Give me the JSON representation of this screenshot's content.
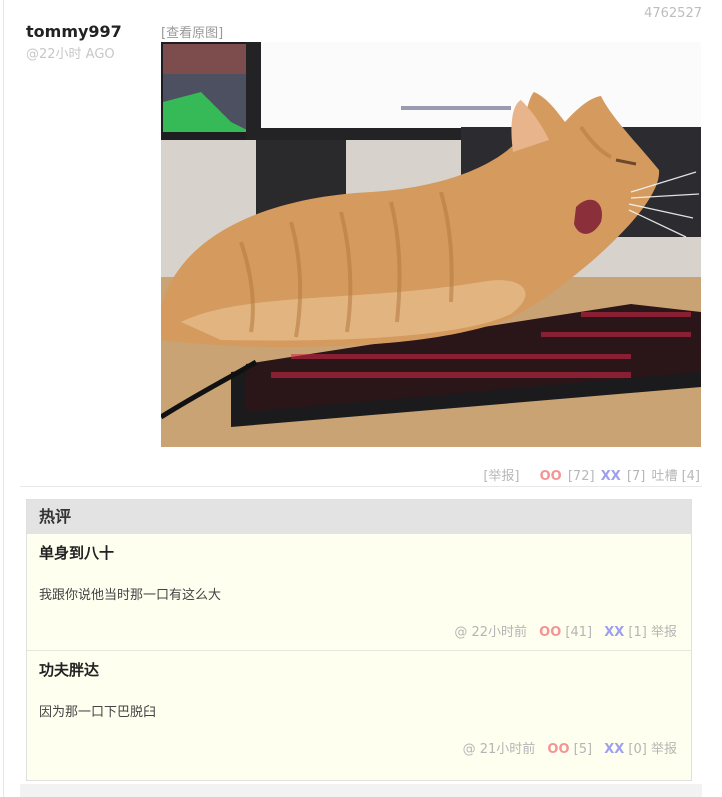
{
  "post": {
    "id": "4762527",
    "author": "tommy997",
    "time": "@22小时 AGO",
    "view_original": "[查看原图]",
    "report": "[举报]",
    "oo_label": "OO",
    "oo_count": "[72]",
    "xx_label": "XX",
    "xx_count": "[7]",
    "tucao": "吐槽 [4]"
  },
  "hot": {
    "title": "热评",
    "comments": [
      {
        "author": "单身到八十",
        "text": "我跟你说他当时那一口有这么大",
        "at": "@",
        "time": "22小时前",
        "oo_label": "OO",
        "oo_count": "[41]",
        "xx_label": "XX",
        "xx_count": "[1]",
        "report": "举报"
      },
      {
        "author": "功夫胖达",
        "text": "因为那一口下巴脱臼",
        "at": "@",
        "time": "21小时前",
        "oo_label": "OO",
        "oo_count": "[5]",
        "xx_label": "XX",
        "xx_count": "[0]",
        "report": "举报"
      }
    ]
  },
  "colors": {
    "oo": "#f49595",
    "xx": "#9f9ff0",
    "hot_bg": "#fffff0",
    "hot_head_bg": "#e3e3e3"
  }
}
